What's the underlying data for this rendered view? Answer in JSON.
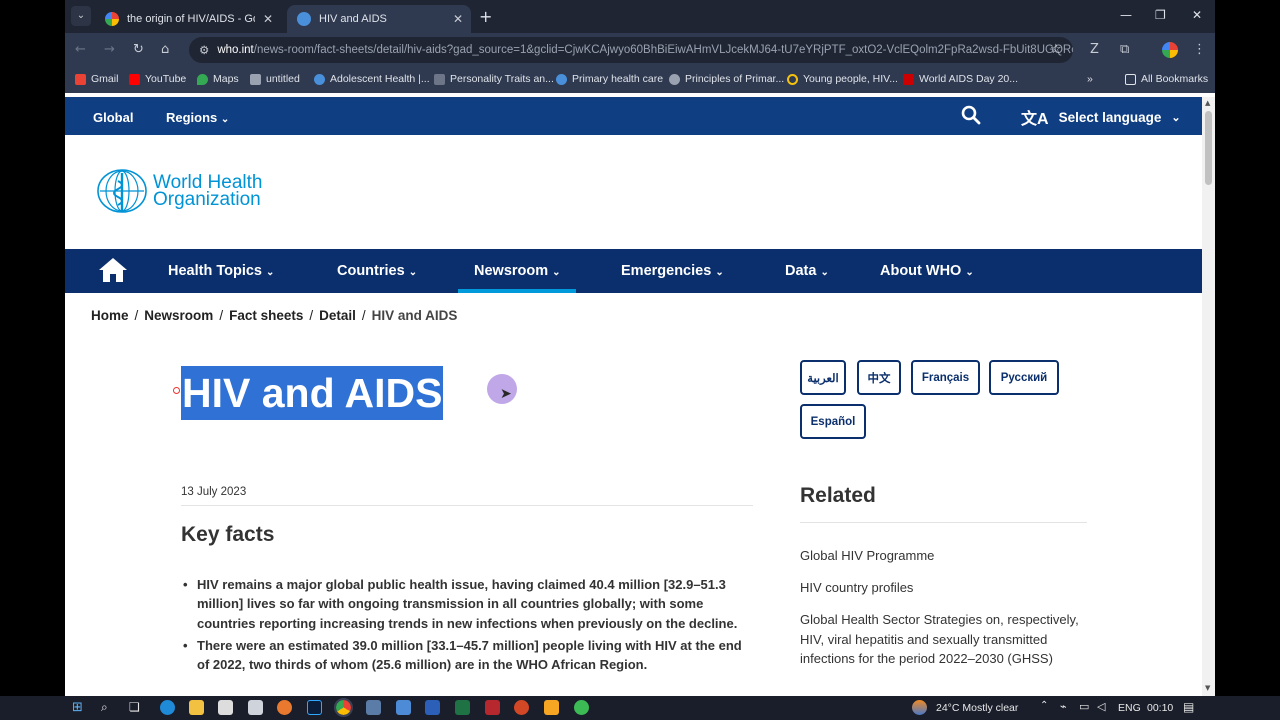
{
  "browser": {
    "tabs": [
      {
        "title": "the origin of HIV/AIDS - Google",
        "favicon_color": "#ffffff",
        "active": false
      },
      {
        "title": "HIV and AIDS",
        "favicon_color": "#4a8fd9",
        "active": true
      }
    ],
    "url_host": "who.int",
    "url_path": "/news-room/fact-sheets/detail/hiv-aids?gad_source=1&gclid=CjwKCAjwyo60BhBiEiwAHmVLJcekMJ64-tU7eYRjPTF_oxtO2-VclEQolm2FpRa2wsd-FbUit8UGQRo...",
    "bookmarks": [
      {
        "label": "Gmail",
        "color": "#ea4335"
      },
      {
        "label": "YouTube",
        "color": "#ff0000"
      },
      {
        "label": "Maps",
        "color": "#34a853"
      },
      {
        "label": "untitled",
        "color": "#9aa2b1"
      },
      {
        "label": "Adolescent Health |...",
        "color": "#4a8fd9"
      },
      {
        "label": "Personality Traits an...",
        "color": "#6d7588"
      },
      {
        "label": "Primary health care",
        "color": "#4a8fd9"
      },
      {
        "label": "Principles of Primar...",
        "color": "#9aa2b1"
      },
      {
        "label": "Young people, HIV...",
        "color": "#f4c20d"
      },
      {
        "label": "World AIDS Day 20...",
        "color": "#cc0000"
      }
    ],
    "all_bookmarks": "All Bookmarks",
    "more_glyph": "»"
  },
  "topbar": {
    "global": "Global",
    "regions": "Regions",
    "language": "Select language"
  },
  "logo": {
    "line1": "World Health",
    "line2": "Organization"
  },
  "nav": {
    "items": [
      "Health Topics",
      "Countries",
      "Newsroom",
      "Emergencies",
      "Data",
      "About WHO"
    ],
    "active": "Newsroom"
  },
  "breadcrumb": {
    "items": [
      "Home",
      "Newsroom",
      "Fact sheets",
      "Detail"
    ],
    "current": "HIV and AIDS"
  },
  "article": {
    "title": "HIV and AIDS",
    "date": "13 July 2023",
    "section": "Key facts",
    "facts": [
      "HIV remains a major global public health issue, having claimed 40.4 million [32.9–51.3 million] lives so far with ongoing transmission in all countries globally; with some countries reporting increasing trends in new infections when previously on the decline.",
      "There were an estimated 39.0 million [33.1–45.7 million] people living with HIV at the end of 2022, two thirds of whom (25.6 million) are in the WHO African Region."
    ]
  },
  "languages": [
    "العربية",
    "中文",
    "Français",
    "Русский",
    "Español"
  ],
  "related": {
    "title": "Related",
    "links": [
      "Global HIV Programme",
      "HIV country profiles",
      "Global Health Sector Strategies on, respectively, HIV, viral hepatitis and sexually transmitted infections for the period 2022–2030 (GHSS)"
    ]
  },
  "taskbar": {
    "weather": "24°C  Mostly clear",
    "lang": "ENG",
    "time": "00:10"
  },
  "colors": {
    "who_blue": "#0b2f6c",
    "who_topbar": "#0f3e82",
    "who_light": "#0093d5",
    "selection": "#2f71d4"
  }
}
